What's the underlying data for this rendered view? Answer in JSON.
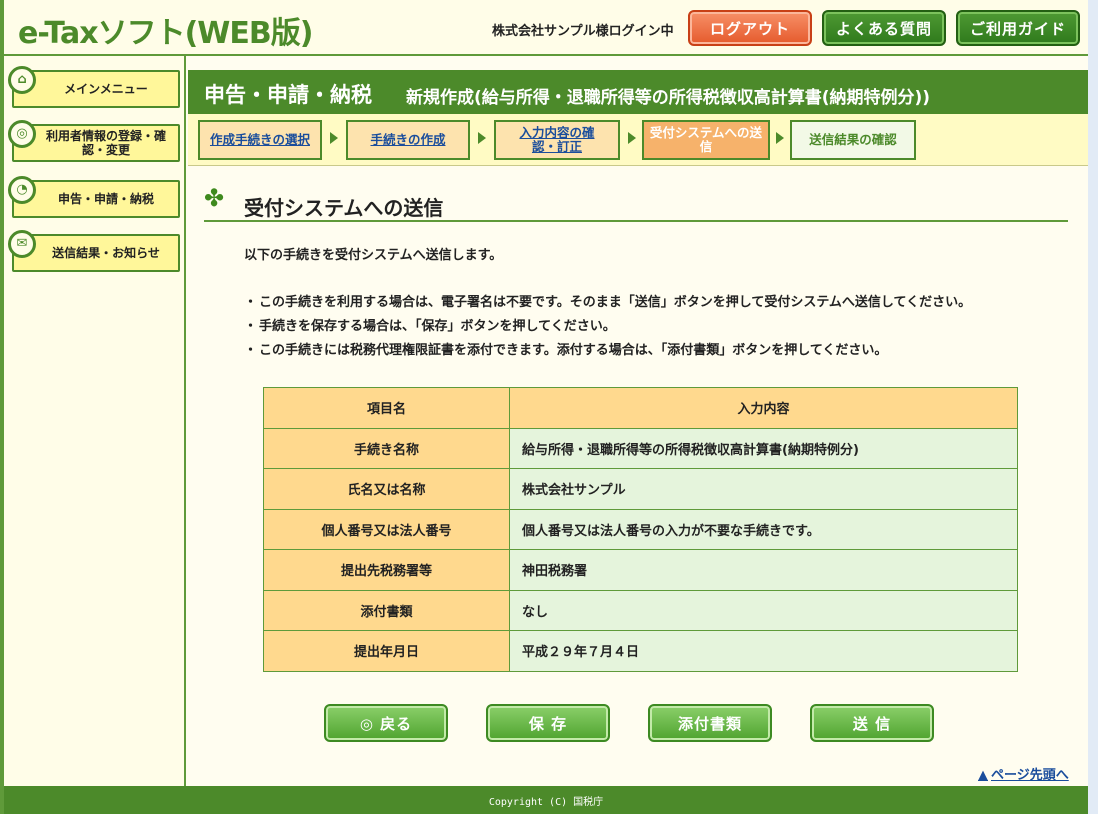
{
  "app": {
    "logo": "e-Taxソフト(WEB版)"
  },
  "header": {
    "login_status": "株式会社サンプル様ログイン中",
    "logout": "ログアウト",
    "faq": "よくある質問",
    "guide": "ご利用ガイド"
  },
  "sidebar": {
    "items": [
      {
        "label": "メインメニュー",
        "icon": "home-icon"
      },
      {
        "label": "利用者情報の登録・確認・変更",
        "icon": "user-settings-icon"
      },
      {
        "label": "申告・申請・納税",
        "icon": "clock-icon"
      },
      {
        "label": "送信結果・お知らせ",
        "icon": "mail-icon"
      }
    ]
  },
  "titlebar": {
    "main": "申告・申請・納税",
    "sub": "新規作成(給与所得・退職所得等の所得税徴収高計算書(納期特例分))"
  },
  "steps": [
    {
      "label": "作成手続きの選択",
      "state": "link"
    },
    {
      "label": "手続きの作成",
      "state": "link"
    },
    {
      "label": "入力内容の確認・訂正",
      "state": "link"
    },
    {
      "label": "受付システムへの送信",
      "state": "current"
    },
    {
      "label": "送信結果の確認",
      "state": "future"
    }
  ],
  "section": {
    "title": "受付システムへの送信"
  },
  "intro": "以下の手続きを受付システムへ送信します。",
  "bullets": [
    "この手続きを利用する場合は、電子署名は不要です。そのまま「送信」ボタンを押して受付システムへ送信してください。",
    "手続きを保存する場合は、「保存」ボタンを押してください。",
    "この手続きには税務代理権限証書を添付できます。添付する場合は、「添付書類」ボタンを押してください。"
  ],
  "table": {
    "headers": [
      "項目名",
      "入力内容"
    ],
    "rows": [
      [
        "手続き名称",
        "給与所得・退職所得等の所得税徴収高計算書(納期特例分)"
      ],
      [
        "氏名又は名称",
        "株式会社サンプル"
      ],
      [
        "個人番号又は法人番号",
        "個人番号又は法人番号の入力が不要な手続きです。"
      ],
      [
        "提出先税務署等",
        "神田税務署"
      ],
      [
        "添付書類",
        "なし"
      ],
      [
        "提出年月日",
        "平成２９年７月４日"
      ]
    ]
  },
  "actions": {
    "back": "◎ 戻る",
    "save": "保 存",
    "attach": "添付書類",
    "send": "送 信"
  },
  "page_top": "ページ先頭へ",
  "footer": "Copyright (C) 国税庁",
  "colors": {
    "accent": "#4c8a2a",
    "logout": "#e55a2c",
    "table_key": "#ffd98e",
    "table_val": "#e5f4dc"
  }
}
